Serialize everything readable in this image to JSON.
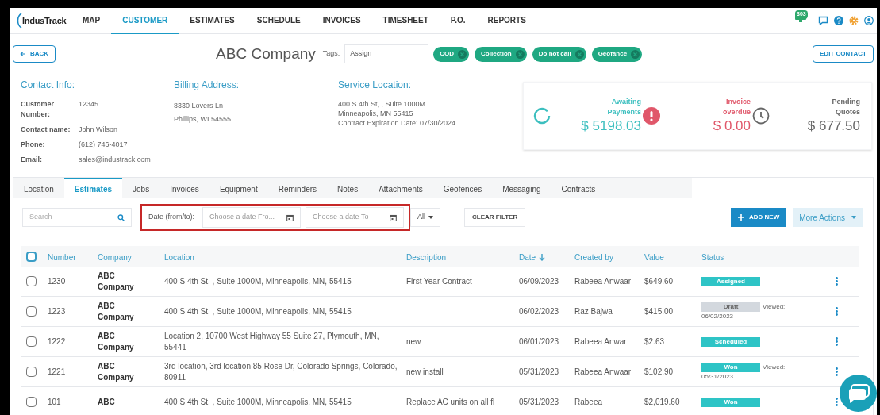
{
  "nav": {
    "logo": "IndusTrack",
    "items": [
      {
        "label": "MAP",
        "selected": false
      },
      {
        "label": "CUSTOMER",
        "selected": true
      },
      {
        "label": "ESTIMATES",
        "selected": false
      },
      {
        "label": "SCHEDULE",
        "selected": false
      },
      {
        "label": "INVOICES",
        "selected": false
      },
      {
        "label": "TIMESHEET",
        "selected": false
      },
      {
        "label": "P.O.",
        "selected": false
      },
      {
        "label": "REPORTS",
        "selected": false
      }
    ],
    "notification_count": "303"
  },
  "header": {
    "back": "BACK",
    "title": "ABC Company",
    "tags_label": "Tags:",
    "tags_input": "Assign",
    "tags": [
      "COD",
      "Collection",
      "Do not call",
      "Geofance"
    ],
    "edit": "EDIT CONTACT"
  },
  "contact": {
    "heading": "Contact Info:",
    "fields": [
      {
        "label": "Customer Number:",
        "value": "12345"
      },
      {
        "label": "Contact name:",
        "value": "John Wilson"
      },
      {
        "label": "Phone:",
        "value": "(612) 746-4017"
      },
      {
        "label": "Email:",
        "value": "sales@industrack.com"
      }
    ]
  },
  "billing": {
    "heading": "Billing Address:",
    "lines": [
      "8330 Lovers Ln",
      "Phillips, WI 54555"
    ]
  },
  "service": {
    "heading": "Service Location:",
    "lines": [
      "400 S 4th St, , Suite 1000M",
      "Minneapolis, MN 55415",
      "Contract Expiration Date: 07/30/2024"
    ]
  },
  "stats": [
    {
      "kind": "ring",
      "label": "Awaiting Payments",
      "value": "$ 5198.03",
      "color": "#3cbfbf"
    },
    {
      "kind": "alert",
      "label": "Invoice overdue",
      "value": "$ 0.00",
      "color": "#e0576a"
    },
    {
      "kind": "clock",
      "label": "Pending Quotes",
      "value": "$ 677.50",
      "color": "#666666"
    }
  ],
  "tabs": [
    {
      "label": "Location",
      "selected": false
    },
    {
      "label": "Estimates",
      "selected": true
    },
    {
      "label": "Jobs",
      "selected": false
    },
    {
      "label": "Invoices",
      "selected": false
    },
    {
      "label": "Equipment",
      "selected": false
    },
    {
      "label": "Reminders",
      "selected": false
    },
    {
      "label": "Notes",
      "selected": false
    },
    {
      "label": "Attachments",
      "selected": false
    },
    {
      "label": "Geofences",
      "selected": false
    },
    {
      "label": "Messaging",
      "selected": false
    },
    {
      "label": "Contracts",
      "selected": false
    }
  ],
  "filters": {
    "search_placeholder": "Search",
    "date_label": "Date (from/to):",
    "from_placeholder": "Choose a date Fro...",
    "to_placeholder": "Choose a date To",
    "period": "All",
    "clear": "CLEAR FILTER",
    "add": "ADD NEW",
    "more": "More Actions"
  },
  "table": {
    "select_all": {
      "checked": false
    },
    "columns": [
      {
        "label": "Number",
        "sorted": false
      },
      {
        "label": "Company",
        "sorted": false
      },
      {
        "label": "Location",
        "sorted": false
      },
      {
        "label": "Description",
        "sorted": false
      },
      {
        "label": "Date",
        "sorted": true
      },
      {
        "label": "Created by",
        "sorted": false
      },
      {
        "label": "Value",
        "sorted": false
      },
      {
        "label": "Status",
        "sorted": false
      }
    ],
    "rows": [
      {
        "checked": false,
        "number": "1230",
        "company": "ABC Company",
        "location": "400 S 4th St, , Suite 1000M, Minneapolis, MN, 55415",
        "description": "First Year Contract",
        "date": "06/09/2023",
        "created_by": "Rabeea Anwaar",
        "value": "$649.60",
        "status": "Assigned",
        "color": "#2ec4c6"
      },
      {
        "checked": false,
        "number": "1223",
        "company": "ABC Company",
        "location": "400 S 4th St, , Suite 1000M, Minneapolis, MN, 55415",
        "date": "06/02/2023",
        "created_by": "Raz Bajwa",
        "value": "$415.00",
        "status": "Draft",
        "color": "#d3d8de",
        "viewed_label": "Viewed:",
        "viewed_date": "06/02/2023"
      },
      {
        "checked": false,
        "number": "1222",
        "company": "ABC Company",
        "location": "Location 2, 10700 West Highway 55 Suite 27, Plymouth, MN, 55441",
        "description": "new",
        "date": "06/01/2023",
        "created_by": "Rabeea Anwar",
        "value": "$2.63",
        "status": "Scheduled",
        "color": "#2ec4c6"
      },
      {
        "checked": false,
        "number": "1221",
        "company": "ABC Company",
        "location": "3rd location, 3rd location 85 Rose Dr, Colorado Springs, Colorado, 80911",
        "description": "new install",
        "date": "05/31/2023",
        "created_by": "Rabeea Anwaar",
        "value": "$102.90",
        "status": "Won",
        "color": "#2ec4c6",
        "viewed_label": "Viewed:",
        "viewed_date": "05/31/2023"
      },
      {
        "checked": false,
        "number": "101",
        "company": "ABC",
        "location": "400 S 4th St, , Suite 1000M, Minneapolis, MN, 55415",
        "description": "Replace AC units on all fl",
        "date": "05/31/2023",
        "created_by": "Rabeea",
        "value": "$2,019.60",
        "status": "Won",
        "color": "#2ec4c6"
      }
    ]
  }
}
